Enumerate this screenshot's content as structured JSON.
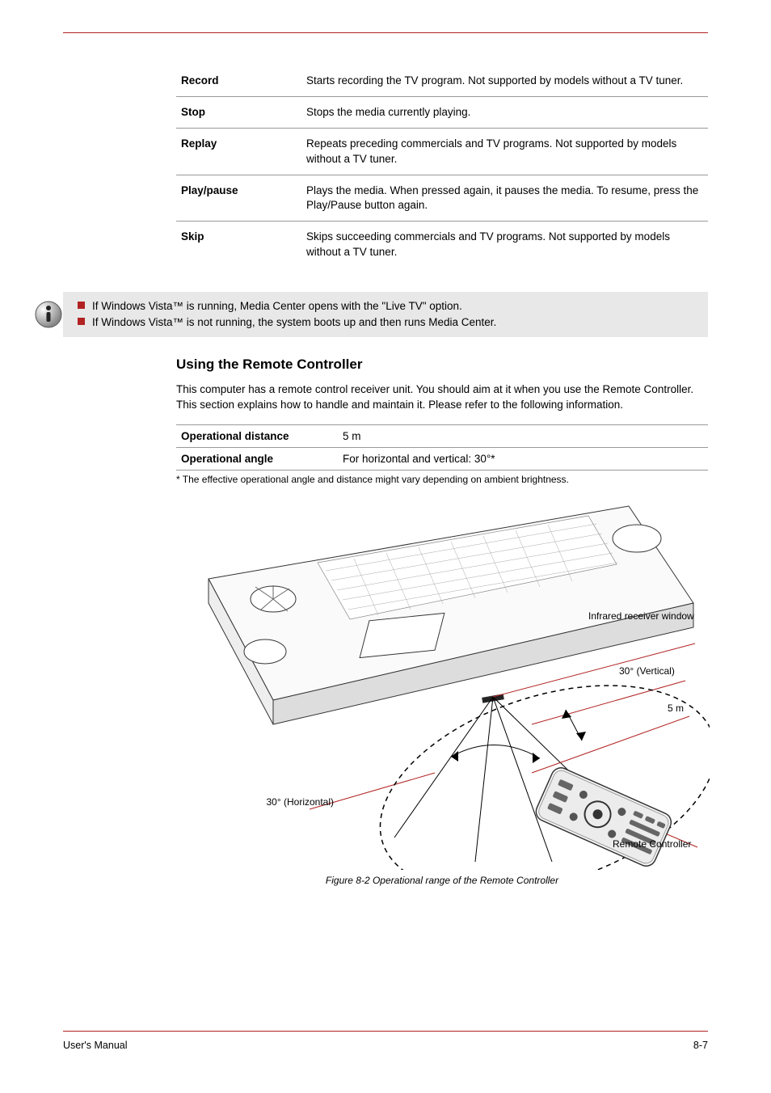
{
  "defs": [
    {
      "term": "Record",
      "text": "Starts recording the TV program. Not supported by models without a TV tuner."
    },
    {
      "term": "Stop",
      "text": "Stops the media currently playing."
    },
    {
      "term": "Replay",
      "text": "Repeats preceding commercials and TV programs. Not supported by models without a TV tuner."
    },
    {
      "term": "Play/pause",
      "text": "Plays the media. When pressed again, it pauses the media. To resume, press the Play/Pause button again."
    },
    {
      "term": "Skip",
      "text": "Skips succeeding commercials and TV programs. Not supported by models without a TV tuner."
    }
  ],
  "info": {
    "items": [
      "If Windows Vista™ is running, Media Center opens with the \"Live TV\" option.",
      "If Windows Vista™ is not running, the system boots up and then runs Media Center."
    ]
  },
  "heading": "Using the Remote Controller",
  "body": "This computer has a remote control receiver unit. You should aim at it when you use the Remote Controller. This section explains how to handle and maintain it. Please refer to the following information.",
  "specs": {
    "distance_k": "Operational distance",
    "distance_v": "5 m",
    "angle_k": "Operational angle",
    "angle_v": "For horizontal and vertical: 30°*"
  },
  "note": "* The effective operational angle and distance might vary depending on ambient brightness.",
  "fig": {
    "recv_window": "Infrared receiver window",
    "h30": "30° (Horizontal)",
    "v30": "30° (Vertical)",
    "five_m": "5 m",
    "remote": "Remote Controller",
    "caption": "Figure 8-2 Operational range of the Remote Controller"
  },
  "footer": {
    "left": "User's Manual",
    "right": "8-7"
  }
}
